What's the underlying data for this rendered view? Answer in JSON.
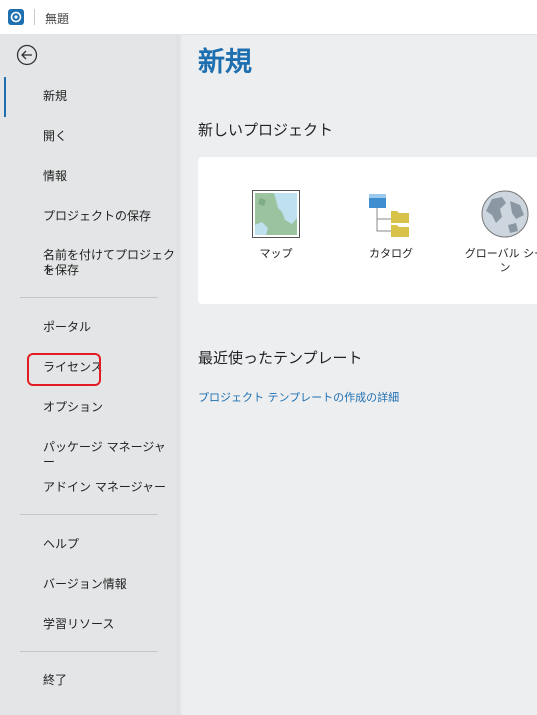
{
  "titlebar": {
    "title": "無題",
    "app_icon": "app-logo-icon"
  },
  "sidebar": {
    "back_icon": "back-arrow-icon",
    "items": [
      {
        "label": "新規"
      },
      {
        "label": "開く"
      },
      {
        "label": "情報"
      },
      {
        "label": "プロジェクトの保存"
      },
      {
        "label": "名前を付けてプロジェクト"
      },
      {
        "label": "を保存"
      },
      {
        "label": "ポータル"
      },
      {
        "label": "ライセンス"
      },
      {
        "label": "オプション"
      },
      {
        "label": "パッケージ マネージャー"
      },
      {
        "label": "アドイン マネージャー"
      },
      {
        "label": "ヘルプ"
      },
      {
        "label": "バージョン情報"
      },
      {
        "label": "学習リソース"
      },
      {
        "label": "終了"
      }
    ]
  },
  "main": {
    "title": "新規",
    "new_project_heading": "新しいプロジェクト",
    "tiles": [
      {
        "label": "マップ",
        "icon": "map-icon"
      },
      {
        "label": "カタログ",
        "icon": "catalog-icon"
      },
      {
        "label": "グローバル シー",
        "label2": "ン",
        "icon": "globe-icon"
      }
    ],
    "recent_heading": "最近使ったテンプレート",
    "template_link": "プロジェクト テンプレートの作成の詳細"
  },
  "colors": {
    "accent": "#1e6fb0",
    "highlight": "#e31b23"
  }
}
